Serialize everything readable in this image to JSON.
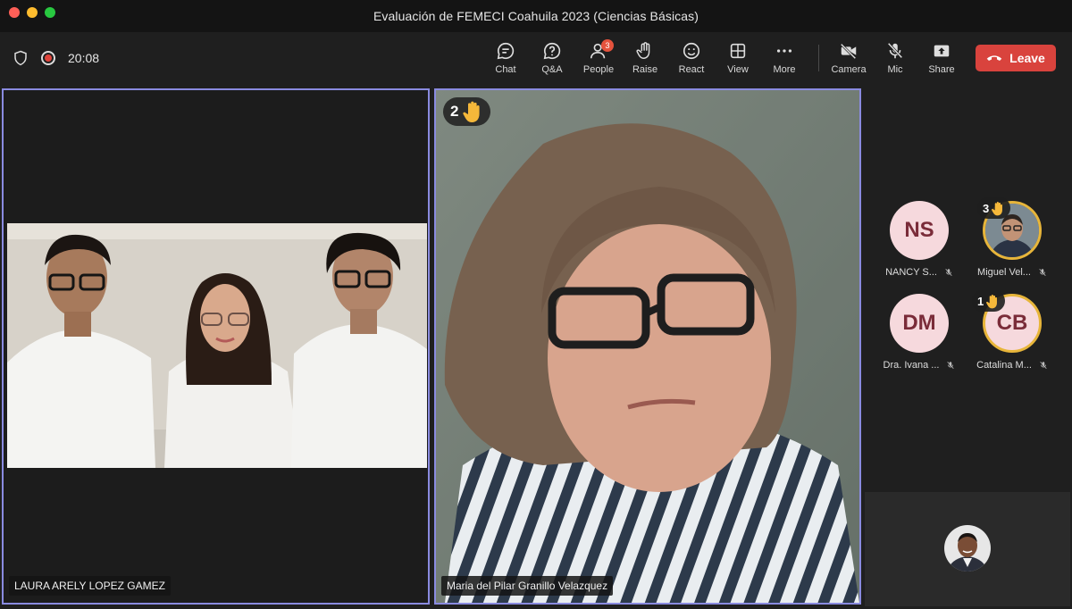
{
  "window": {
    "title": "Evaluación de FEMECI Coahuila 2023 (Ciencias Básicas)"
  },
  "toolbar": {
    "timer": "20:08",
    "chat": "Chat",
    "qa": "Q&A",
    "people": "People",
    "people_badge": "3",
    "raise": "Raise",
    "react": "React",
    "view": "View",
    "more": "More",
    "camera": "Camera",
    "mic": "Mic",
    "share": "Share",
    "leave": "Leave"
  },
  "tiles": [
    {
      "name": "LAURA ARELY LOPEZ GAMEZ"
    },
    {
      "name": "Maria del Pilar Granillo Velazquez",
      "hand_count": "2"
    }
  ],
  "participants": [
    {
      "initials": "NS",
      "name": "NANCY S...",
      "muted": true
    },
    {
      "initials": "",
      "name": "Miguel Vel...",
      "muted": true,
      "hand_count": "3"
    },
    {
      "initials": "DM",
      "name": "Dra. Ivana ...",
      "muted": true
    },
    {
      "initials": "CB",
      "name": "Catalina M...",
      "muted": true,
      "hand_count": "1"
    }
  ],
  "colors": {
    "accent_border": "#8a8be0",
    "leave_bg": "#d9433d",
    "avatar_bg": "#f6d9dd",
    "hand": "#f5b83a"
  }
}
